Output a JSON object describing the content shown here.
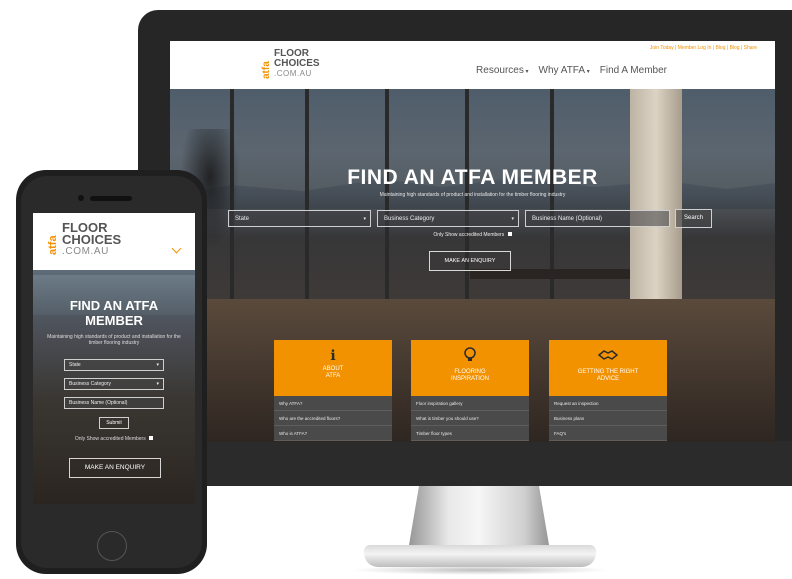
{
  "desktop": {
    "logo": {
      "side": "atfa",
      "line1": "FLOOR",
      "line2": "CHOICES",
      "line3": ".COM.AU"
    },
    "utility_text": "Join Today | Member Log In | Blog | Blog | Share",
    "nav": [
      {
        "label": "Resources",
        "chevron": "chevron-down"
      },
      {
        "label": "Why ATFA",
        "chevron": "chevron-down"
      },
      {
        "label": "Find A Member"
      }
    ],
    "hero": {
      "title": "FIND AN ATFA MEMBER",
      "subtitle": "Maintaining high standards of product and installation for the timber flooring industry",
      "state_placeholder": "State",
      "category_placeholder": "Business Category",
      "business_placeholder": "Business Name (Optional)",
      "search_label": "Search",
      "checkbox_label": "Only Show accredited Members",
      "enquiry_label": "MAKE AN ENQUIRY"
    },
    "cards": [
      {
        "icon": "info-icon",
        "glyph": "ℹ",
        "title": "ABOUT\nATFA",
        "items": [
          "Why ATFA?",
          "Who are the accredited floors?",
          "Who is ATFA?"
        ]
      },
      {
        "icon": "lightbulb-icon",
        "glyph": "💡",
        "title": "FLOORING\nINSPIRATION",
        "items": [
          "Floor inspiration gallery",
          "What is timber you should use?",
          "Timber floor types"
        ]
      },
      {
        "icon": "handshake-icon",
        "glyph": "🤝",
        "title": "GETTING THE RIGHT\nADVICE",
        "items": [
          "Request an inspection",
          "Business plans",
          "FAQ's"
        ]
      }
    ]
  },
  "mobile": {
    "logo": {
      "side": "atfa",
      "line1": "FLOOR",
      "line2": "CHOICES",
      "line3": ".COM.AU"
    },
    "menu_icon": "menu-icon",
    "title_line1": "FIND AN ATFA",
    "title_line2": "MEMBER",
    "subtitle": "Maintaining high standards of product and installation for the timber flooring industry",
    "state_placeholder": "State",
    "category_placeholder": "Business Category",
    "business_placeholder": "Business Name (Optional)",
    "submit_label": "Submit",
    "checkbox_label": "Only Show accredited Members",
    "enquiry_label": "MAKE AN ENQUIRY"
  },
  "colors": {
    "brand_orange": "#f39200",
    "dark_panel": "#4a4a4a"
  }
}
